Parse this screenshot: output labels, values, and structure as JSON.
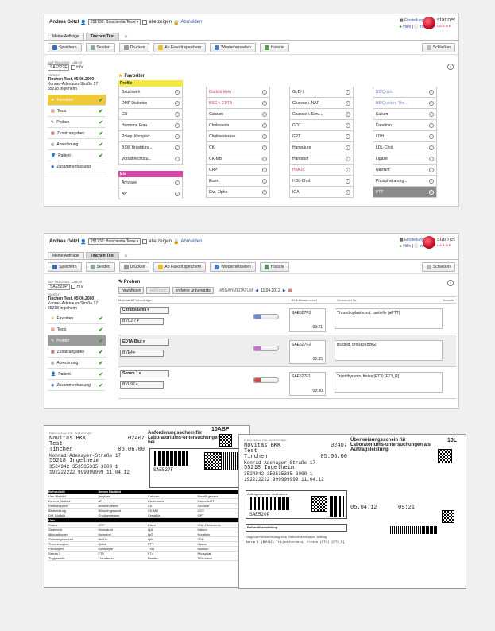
{
  "screen1": {
    "user": "Andrea Götzl",
    "client_select": "251732: Bioscientia Teste",
    "show_all": "alle zeigen",
    "logout": "Abmelden",
    "settings": "Einstellungen",
    "help": "Hilfe",
    "info": "Info",
    "logo": "star.net",
    "logo_sub": "LABOR",
    "tabs": [
      "Meine Aufträge",
      "Tinchen Test"
    ],
    "toolbar": [
      "Speichern",
      "Senden",
      "Drucken",
      "Ab Favorit speichern",
      "Wiederherstellen",
      "Historie"
    ],
    "close": "Schließen",
    "order_label": "AUFTRAGSNR. LABOR",
    "order_value": "SAE522F",
    "hiv": "HIV",
    "patient_label": "PATIENT",
    "patient_name": "Tinchen Test, 05.06.2000",
    "patient_addr1": "Konrad-Adenauer-Straße 17",
    "patient_addr2": "55218 Ingelheim",
    "nav": [
      "Favoriten",
      "Tests",
      "Proben",
      "Zusatzangaben",
      "Abrechnung",
      "Patient",
      "Zusammenfassung"
    ],
    "favorites_title": "Favoriten",
    "col1_header": "Profile",
    "col1": [
      "Bauchweh",
      "DMP Diabetes",
      "GU",
      "Hormone Frau",
      "Präop. Komplex",
      "BSW Brüstdurs...",
      "Vorsahrechtstu..."
    ],
    "col1_header2": "EG",
    "col1b": [
      "Amylase",
      "AP"
    ],
    "col2": [
      "Blutbild klein",
      "BSG + EDTA",
      "Calcium",
      "Cholesterin",
      "Cholinesterase",
      "CK",
      "CK-MB",
      "CRP",
      "Eisen",
      "Elw. Elpho"
    ],
    "col3": [
      "GLDH",
      "Glucose i. NAF",
      "Glucose i. Seru...",
      "GOT",
      "GPT",
      "Harnsäure",
      "Harnstoff",
      "HbA1c",
      "HDL-Chol.",
      "IGA"
    ],
    "col4": [
      "BB/Quick",
      "BB/Quick n. The...",
      "Kalium",
      "Kreatinin",
      "LDH",
      "LDL-Chol.",
      "Lipase",
      "Natrium",
      "Phosphat anorg...",
      "PTT"
    ]
  },
  "screen2": {
    "user": "Andrea Götzl",
    "client_select": "251732: Bioscientia Teste",
    "show_all": "alle zeigen",
    "logout": "Abmelden",
    "settings": "Einstellungen",
    "help": "Hilfe",
    "info": "Info",
    "logo": "star.net",
    "logo_sub": "LABOR",
    "tabs": [
      "Meine Aufträge",
      "Tinchen Test"
    ],
    "toolbar": [
      "Speichern",
      "Senden",
      "Drucken",
      "Ab Favorit speichern",
      "Wiederherstellen",
      "Historie"
    ],
    "close": "Schließen",
    "order_label": "AUFTRAGSNR. LABOR",
    "order_value": "SAE520P",
    "hiv": "HIV",
    "patient_label": "PATIENT",
    "patient_name": "Tinchen Test, 05.06.2000",
    "patient_addr1": "Konrad-Adenauer-Straße 17",
    "patient_addr2": "55218 Ingelheim",
    "nav": [
      "Favoriten",
      "Tests",
      "Proben",
      "Zusatzangaben",
      "Abrechnung",
      "Patient",
      "Zusammenfassung"
    ],
    "proben_title": "Proben",
    "btn_add": "hinzufügen",
    "btn_remove": "entfernen",
    "btn_remove_unused": "entferne unbenutzte",
    "date_label": "ABNAHMEDATUM",
    "date_value": "11.04.2012",
    "col_headers": [
      "Material & Probenträger",
      "ID & Abnahmezeit",
      "Verwendet für",
      "Verweis"
    ],
    "rows": [
      {
        "material": "Citratplasma",
        "carrier": "BVC2,7",
        "id": "SAE527F3",
        "time": "09:21",
        "used": "Thromboplastinzeit, partielle (aPTT)"
      },
      {
        "material": "EDTA-Blut",
        "carrier": "BVE4",
        "id": "SAE527F2",
        "time": "08:35",
        "used": "Blutbild, großes [BBG]"
      },
      {
        "material": "Serum 1",
        "carrier": "BVU92",
        "id": "SAE527F1",
        "time": "08:30",
        "used": "Trijodthyronin, freies (FT3) [FT3_R]"
      }
    ]
  },
  "forms": {
    "f1_title": "Anforderungsschein für Laboratoriums-untersuchungen bei",
    "f1_code": "10ABF",
    "f1_insurer": "Novitas BKK",
    "f1_insurer_no": "02407",
    "f1_name": "Test",
    "f1_first": "Tinchen",
    "f1_dob": "05.06.00",
    "f1_street": "Konrad-Adenauer-Straße 17",
    "f1_city": "55218 Ingelheim",
    "f1_num1": "3524942",
    "f1_num2": "353535335",
    "f1_num3": "3000 1",
    "f1_num4": "192222222",
    "f1_num5": "999999999",
    "f1_date": "11.04.12",
    "f1_sample_id": "SAE527F",
    "f1_section1": "Befund eilt",
    "f1_section2": "Serum Blutbild",
    "f2_title": "Überweisungsschein für Laboratoriums-untersuchungen als Auftragsleistung",
    "f2_code": "10L",
    "f2_insurer": "Novitas BKK",
    "f2_insurer_no": "02407",
    "f2_name": "Test",
    "f2_first": "Tinchen",
    "f2_dob": "05.06.00",
    "f2_street": "Konrad-Adenauer-Straße 17",
    "f2_city": "55218 Ingelheim",
    "f2_num1": "3524942",
    "f2_num2": "353535335",
    "f2_num3": "3000 1",
    "f2_num4": "192222222",
    "f2_num5": "999999999",
    "f2_date": "11.04.12",
    "f2_lab_label": "Auftragsnummer des Labors",
    "f2_order": "SAE520F",
    "f2_abnahme_date": "05.04.12",
    "f2_abnahme_time": "09:21",
    "f2_result": "Befundübermittlung",
    "f2_diag": "Diagnose/Verdachtsdiagnose, Befund/Medikation, Auftrag",
    "f2_line": "Serum 1  (BVU92)  Trijodthyronin, freies (FT3) [FT3_R]"
  },
  "colors": {
    "yellow_header": "#f3e93f",
    "pink_header": "#d548a8",
    "nav_active": "#f0c838",
    "accent_red": "#c4102a"
  }
}
